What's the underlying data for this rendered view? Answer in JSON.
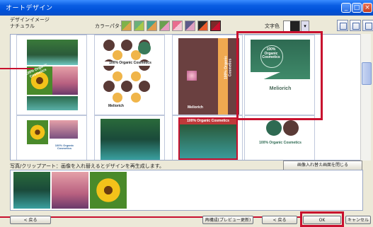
{
  "window": {
    "title": "オートデザイン"
  },
  "toolbar": {
    "design_label_line1": "デザインイメージ",
    "design_label_line2": "ナチュラル",
    "color_pattern_label": "カラーパターン",
    "font_color_label": "文字色",
    "swatches": [
      {
        "c1": "#7fb24a",
        "c2": "#d9a34b"
      },
      {
        "c1": "#6bb07a",
        "c2": "#a8c84a"
      },
      {
        "c1": "#4aa08c",
        "c2": "#e29a4a"
      },
      {
        "c1": "#6aa050",
        "c2": "#e69ac0"
      },
      {
        "c1": "#e96c8e",
        "c2": "#f4c8d6"
      },
      {
        "c1": "#5c5a8a",
        "c2": "#e0a0c0"
      },
      {
        "c1": "#2a2a2a",
        "c2": "#e85a2a"
      },
      {
        "c1": "#7a2a2a",
        "c2": "#c8102e"
      }
    ]
  },
  "templates": {
    "text_organic": "100% Organic Cosmetics",
    "text_brand": "Meliorich",
    "text_organic_line1": "100%",
    "text_organic_line2": "Organic",
    "text_organic_line3": "Cosmetics"
  },
  "photos": {
    "label": "写真/クリップアート：画像を入れ替えるとデザインを再生成します。",
    "replace_button": "画像入れ替え画面を閉じる"
  },
  "buttons": {
    "back": "< 戻る",
    "regenerate": "再構成(プレビュー更新)",
    "apply": "< 戻る",
    "ok": "OK",
    "cancel": "キャンセル"
  }
}
